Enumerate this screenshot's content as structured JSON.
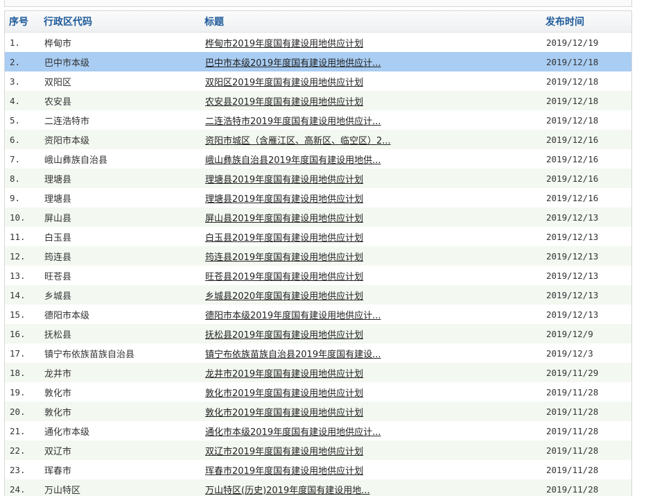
{
  "columns": {
    "index": "序号",
    "region": "行政区代码",
    "title": "标题",
    "date": "发布时间"
  },
  "rows": [
    {
      "index": "1.",
      "region": "桦甸市",
      "title": "桦甸市2019年度国有建设用地供应计划",
      "date": "2019/12/19"
    },
    {
      "index": "2.",
      "region": "巴中市本级",
      "title": "巴中市本级2019年度国有建设用地供应计...",
      "date": "2019/12/18"
    },
    {
      "index": "3.",
      "region": "双阳区",
      "title": "双阳区2019年度国有建设用地供应计划",
      "date": "2019/12/18"
    },
    {
      "index": "4.",
      "region": "农安县",
      "title": "农安县2019年度国有建设用地供应计划",
      "date": "2019/12/18"
    },
    {
      "index": "5.",
      "region": "二连浩特市",
      "title": "二连浩特市2019年度国有建设用地供应计...",
      "date": "2019/12/18"
    },
    {
      "index": "6.",
      "region": "资阳市本级",
      "title": "资阳市城区（含雁江区、高新区、临空区）2...",
      "date": "2019/12/16"
    },
    {
      "index": "7.",
      "region": "峨山彝族自治县",
      "title": "峨山彝族自治县2019年度国有建设用地供...",
      "date": "2019/12/16"
    },
    {
      "index": "8.",
      "region": "理塘县",
      "title": "理塘县2019年度国有建设用地供应计划",
      "date": "2019/12/16"
    },
    {
      "index": "9.",
      "region": "理塘县",
      "title": "理塘县2019年度国有建设用地供应计划",
      "date": "2019/12/16"
    },
    {
      "index": "10.",
      "region": "屏山县",
      "title": "屏山县2019年度国有建设用地供应计划",
      "date": "2019/12/13"
    },
    {
      "index": "11.",
      "region": "白玉县",
      "title": "白玉县2019年度国有建设用地供应计划",
      "date": "2019/12/13"
    },
    {
      "index": "12.",
      "region": "筠连县",
      "title": "筠连县2019年度国有建设用地供应计划",
      "date": "2019/12/13"
    },
    {
      "index": "13.",
      "region": "旺苍县",
      "title": "旺苍县2019年度国有建设用地供应计划",
      "date": "2019/12/13"
    },
    {
      "index": "14.",
      "region": "乡城县",
      "title": "乡城县2020年度国有建设用地供应计划",
      "date": "2019/12/13"
    },
    {
      "index": "15.",
      "region": "德阳市本级",
      "title": "德阳市本级2019年度国有建设用地供应计...",
      "date": "2019/12/13"
    },
    {
      "index": "16.",
      "region": "抚松县",
      "title": "抚松县2019年度国有建设用地供应计划",
      "date": "2019/12/9"
    },
    {
      "index": "17.",
      "region": "镇宁布依族苗族自治县",
      "title": "镇宁布依族苗族自治县2019年度国有建设...",
      "date": "2019/12/3"
    },
    {
      "index": "18.",
      "region": "龙井市",
      "title": "龙井市2019年度国有建设用地供应计划",
      "date": "2019/11/29"
    },
    {
      "index": "19.",
      "region": "敦化市",
      "title": "敦化市2019年度国有建设用地供应计划",
      "date": "2019/11/28"
    },
    {
      "index": "20.",
      "region": "敦化市",
      "title": "敦化市2019年度国有建设用地供应计划",
      "date": "2019/11/28"
    },
    {
      "index": "21.",
      "region": "通化市本级",
      "title": "通化市本级2019年度国有建设用地供应计...",
      "date": "2019/11/28"
    },
    {
      "index": "22.",
      "region": "双辽市",
      "title": "双辽市2019年度国有建设用地供应计划",
      "date": "2019/11/28"
    },
    {
      "index": "23.",
      "region": "珲春市",
      "title": "珲春市2019年度国有建设用地供应计划",
      "date": "2019/11/28"
    },
    {
      "index": "24.",
      "region": "万山特区",
      "title": "万山特区(历史)2019年度国有建设用地...",
      "date": "2019/11/28"
    }
  ],
  "selected_row": 2,
  "colors": {
    "header_text": "#1e5a9a",
    "alt_row": "#f3f8f1",
    "selected_row": "#a9cdf3"
  }
}
